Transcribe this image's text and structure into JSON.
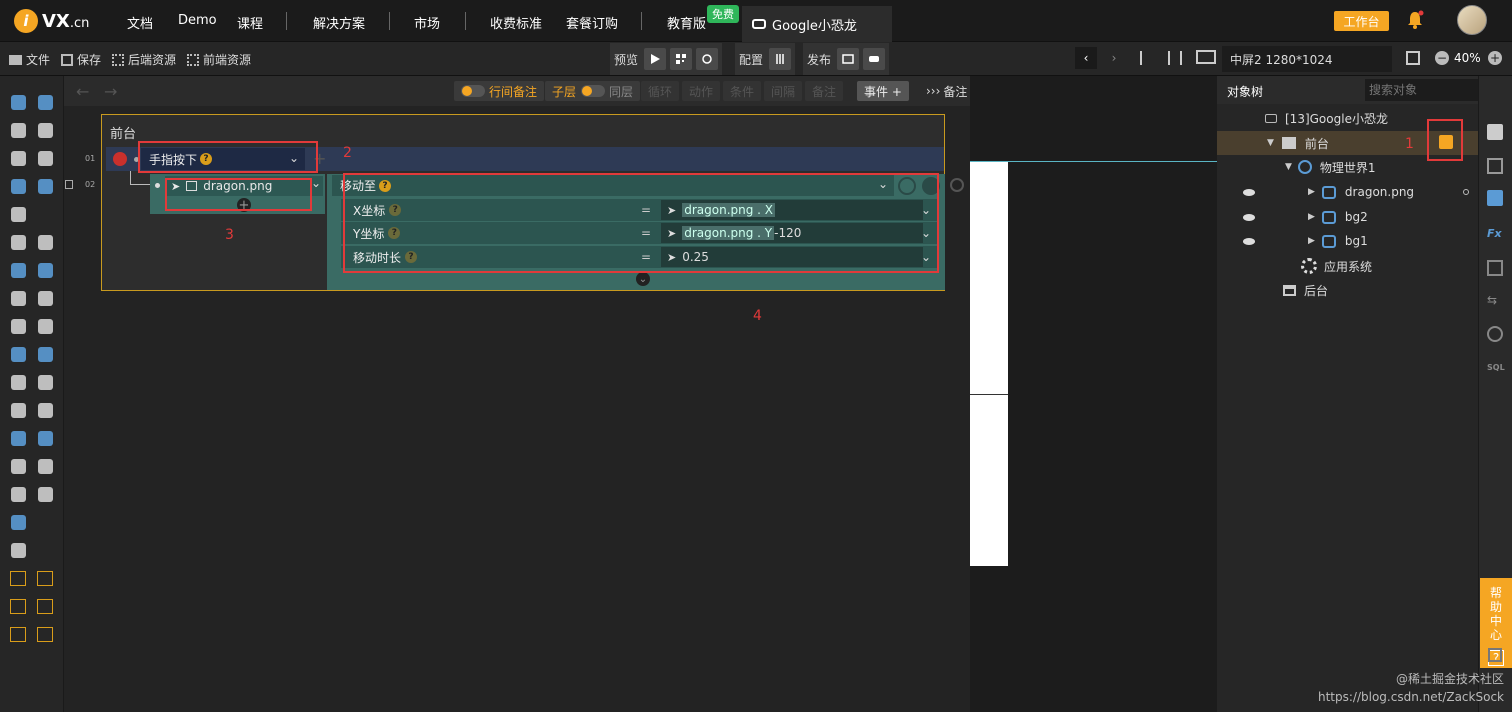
{
  "nav": {
    "logo_main": "VX",
    "logo_suffix": ".cn",
    "items": [
      "文档",
      "Demo",
      "课程",
      "解决方案",
      "市场",
      "收费标准",
      "套餐订购",
      "教育版"
    ],
    "free_badge": "免费",
    "active_tab": "Google小恐龙",
    "workbench_button": "工作台"
  },
  "toolbar": {
    "file": "文件",
    "save": "保存",
    "backend_resources": "后端资源",
    "frontend_resources": "前端资源",
    "preview": "预览",
    "config": "配置",
    "publish": "发布",
    "screen_size": "中屏2 1280*1024",
    "zoom": "40%"
  },
  "editor_header": {
    "inline_note": "行间备注",
    "child_layer": "子层",
    "same_layer": "同层",
    "loop": "循环",
    "action": "动作",
    "condition": "条件",
    "interval": "间隔",
    "remark": "备注",
    "event_add": "事件 +",
    "notes": "备注"
  },
  "panel": {
    "title": "前台",
    "row1_num": "01",
    "row2_num": "02",
    "trigger": "手指按下",
    "target": "dragon.png",
    "action": "移动至",
    "params": [
      {
        "label": "X坐标",
        "eq": "=",
        "ref": "dragon.png . X",
        "suffix": ""
      },
      {
        "label": "Y坐标",
        "eq": "=",
        "ref": "dragon.png . Y",
        "suffix": "-120"
      },
      {
        "label": "移动时长",
        "eq": "=",
        "ref": "",
        "suffix": "0.25"
      }
    ]
  },
  "annotations": [
    "1",
    "2",
    "3",
    "4"
  ],
  "object_tree": {
    "tab": "对象树",
    "search_placeholder": "搜索对象",
    "root": "[13]Google小恐龙",
    "front": "前台",
    "physics": "物理世界1",
    "children": [
      "dragon.png",
      "bg2",
      "bg1"
    ],
    "app_system": "应用系统",
    "backend": "后台"
  },
  "help": [
    "帮",
    "助",
    "中",
    "心",
    "?"
  ],
  "watermark": {
    "line1": "@稀土掘金技术社区",
    "line2": "https://blog.csdn.net/ZackSock"
  }
}
